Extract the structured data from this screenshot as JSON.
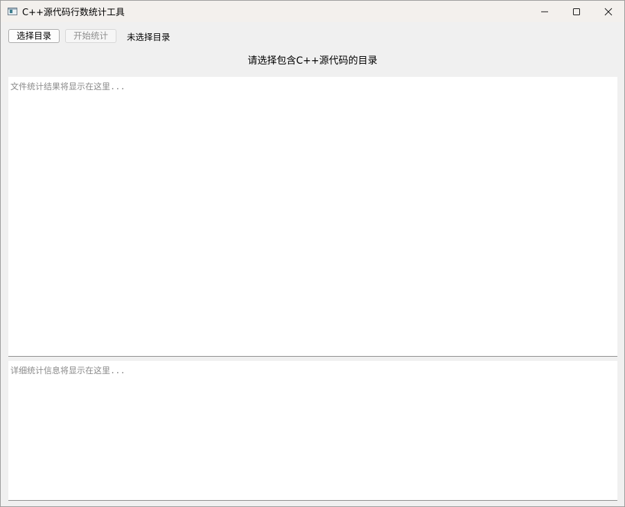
{
  "window": {
    "title": "C++源代码行数统计工具",
    "controls": {
      "minimize": "minimize-icon",
      "maximize": "maximize-icon",
      "close": "close-icon"
    }
  },
  "toolbar": {
    "select_dir_label": "选择目录",
    "start_label": "开始统计",
    "dir_status": "未选择目录"
  },
  "prompt": "请选择包含C++源代码的目录",
  "results": {
    "placeholder": "文件统计结果将显示在这里..."
  },
  "details": {
    "placeholder": "详细统计信息将显示在这里..."
  }
}
